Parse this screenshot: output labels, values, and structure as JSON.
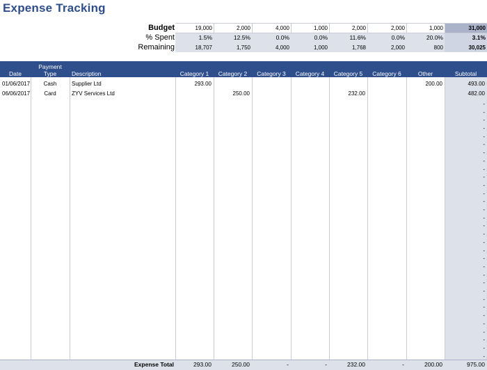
{
  "title": "Expense Tracking",
  "summary": {
    "labels": {
      "budget": "Budget",
      "spent": "% Spent",
      "remaining": "Remaining"
    },
    "budget": [
      "19,000",
      "2,000",
      "4,000",
      "1,000",
      "2,000",
      "2,000",
      "1,000",
      "31,000"
    ],
    "spent": [
      "1.5%",
      "12.5%",
      "0.0%",
      "0.0%",
      "11.6%",
      "0.0%",
      "20.0%",
      "3.1%"
    ],
    "remaining": [
      "18,707",
      "1,750",
      "4,000",
      "1,000",
      "1,768",
      "2,000",
      "800",
      "30,025"
    ]
  },
  "columns": {
    "date": "Date",
    "payment_type_1": "Payment",
    "payment_type_2": "Type",
    "description": "Description",
    "cat1": "Category 1",
    "cat2": "Category 2",
    "cat3": "Category 3",
    "cat4": "Category 4",
    "cat5": "Category 5",
    "cat6": "Category 6",
    "other": "Other",
    "subtotal": "Subtotal"
  },
  "rows": [
    {
      "date": "01/06/2017",
      "type": "Cash",
      "description": "Supplier Ltd",
      "cat1": "293.00",
      "cat2": "",
      "cat3": "",
      "cat4": "",
      "cat5": "",
      "cat6": "",
      "other": "200.00",
      "subtotal": "493.00"
    },
    {
      "date": "06/06/2017",
      "type": "Card",
      "description": "ZYV Services Ltd",
      "cat1": "",
      "cat2": "250.00",
      "cat3": "",
      "cat4": "",
      "cat5": "232.00",
      "cat6": "",
      "other": "",
      "subtotal": "482.00"
    }
  ],
  "empty_subtotal": "-",
  "footer": {
    "label": "Expense Total",
    "values": [
      "293.00",
      "250.00",
      "-",
      "-",
      "232.00",
      "-",
      "200.00",
      "975.00"
    ]
  }
}
